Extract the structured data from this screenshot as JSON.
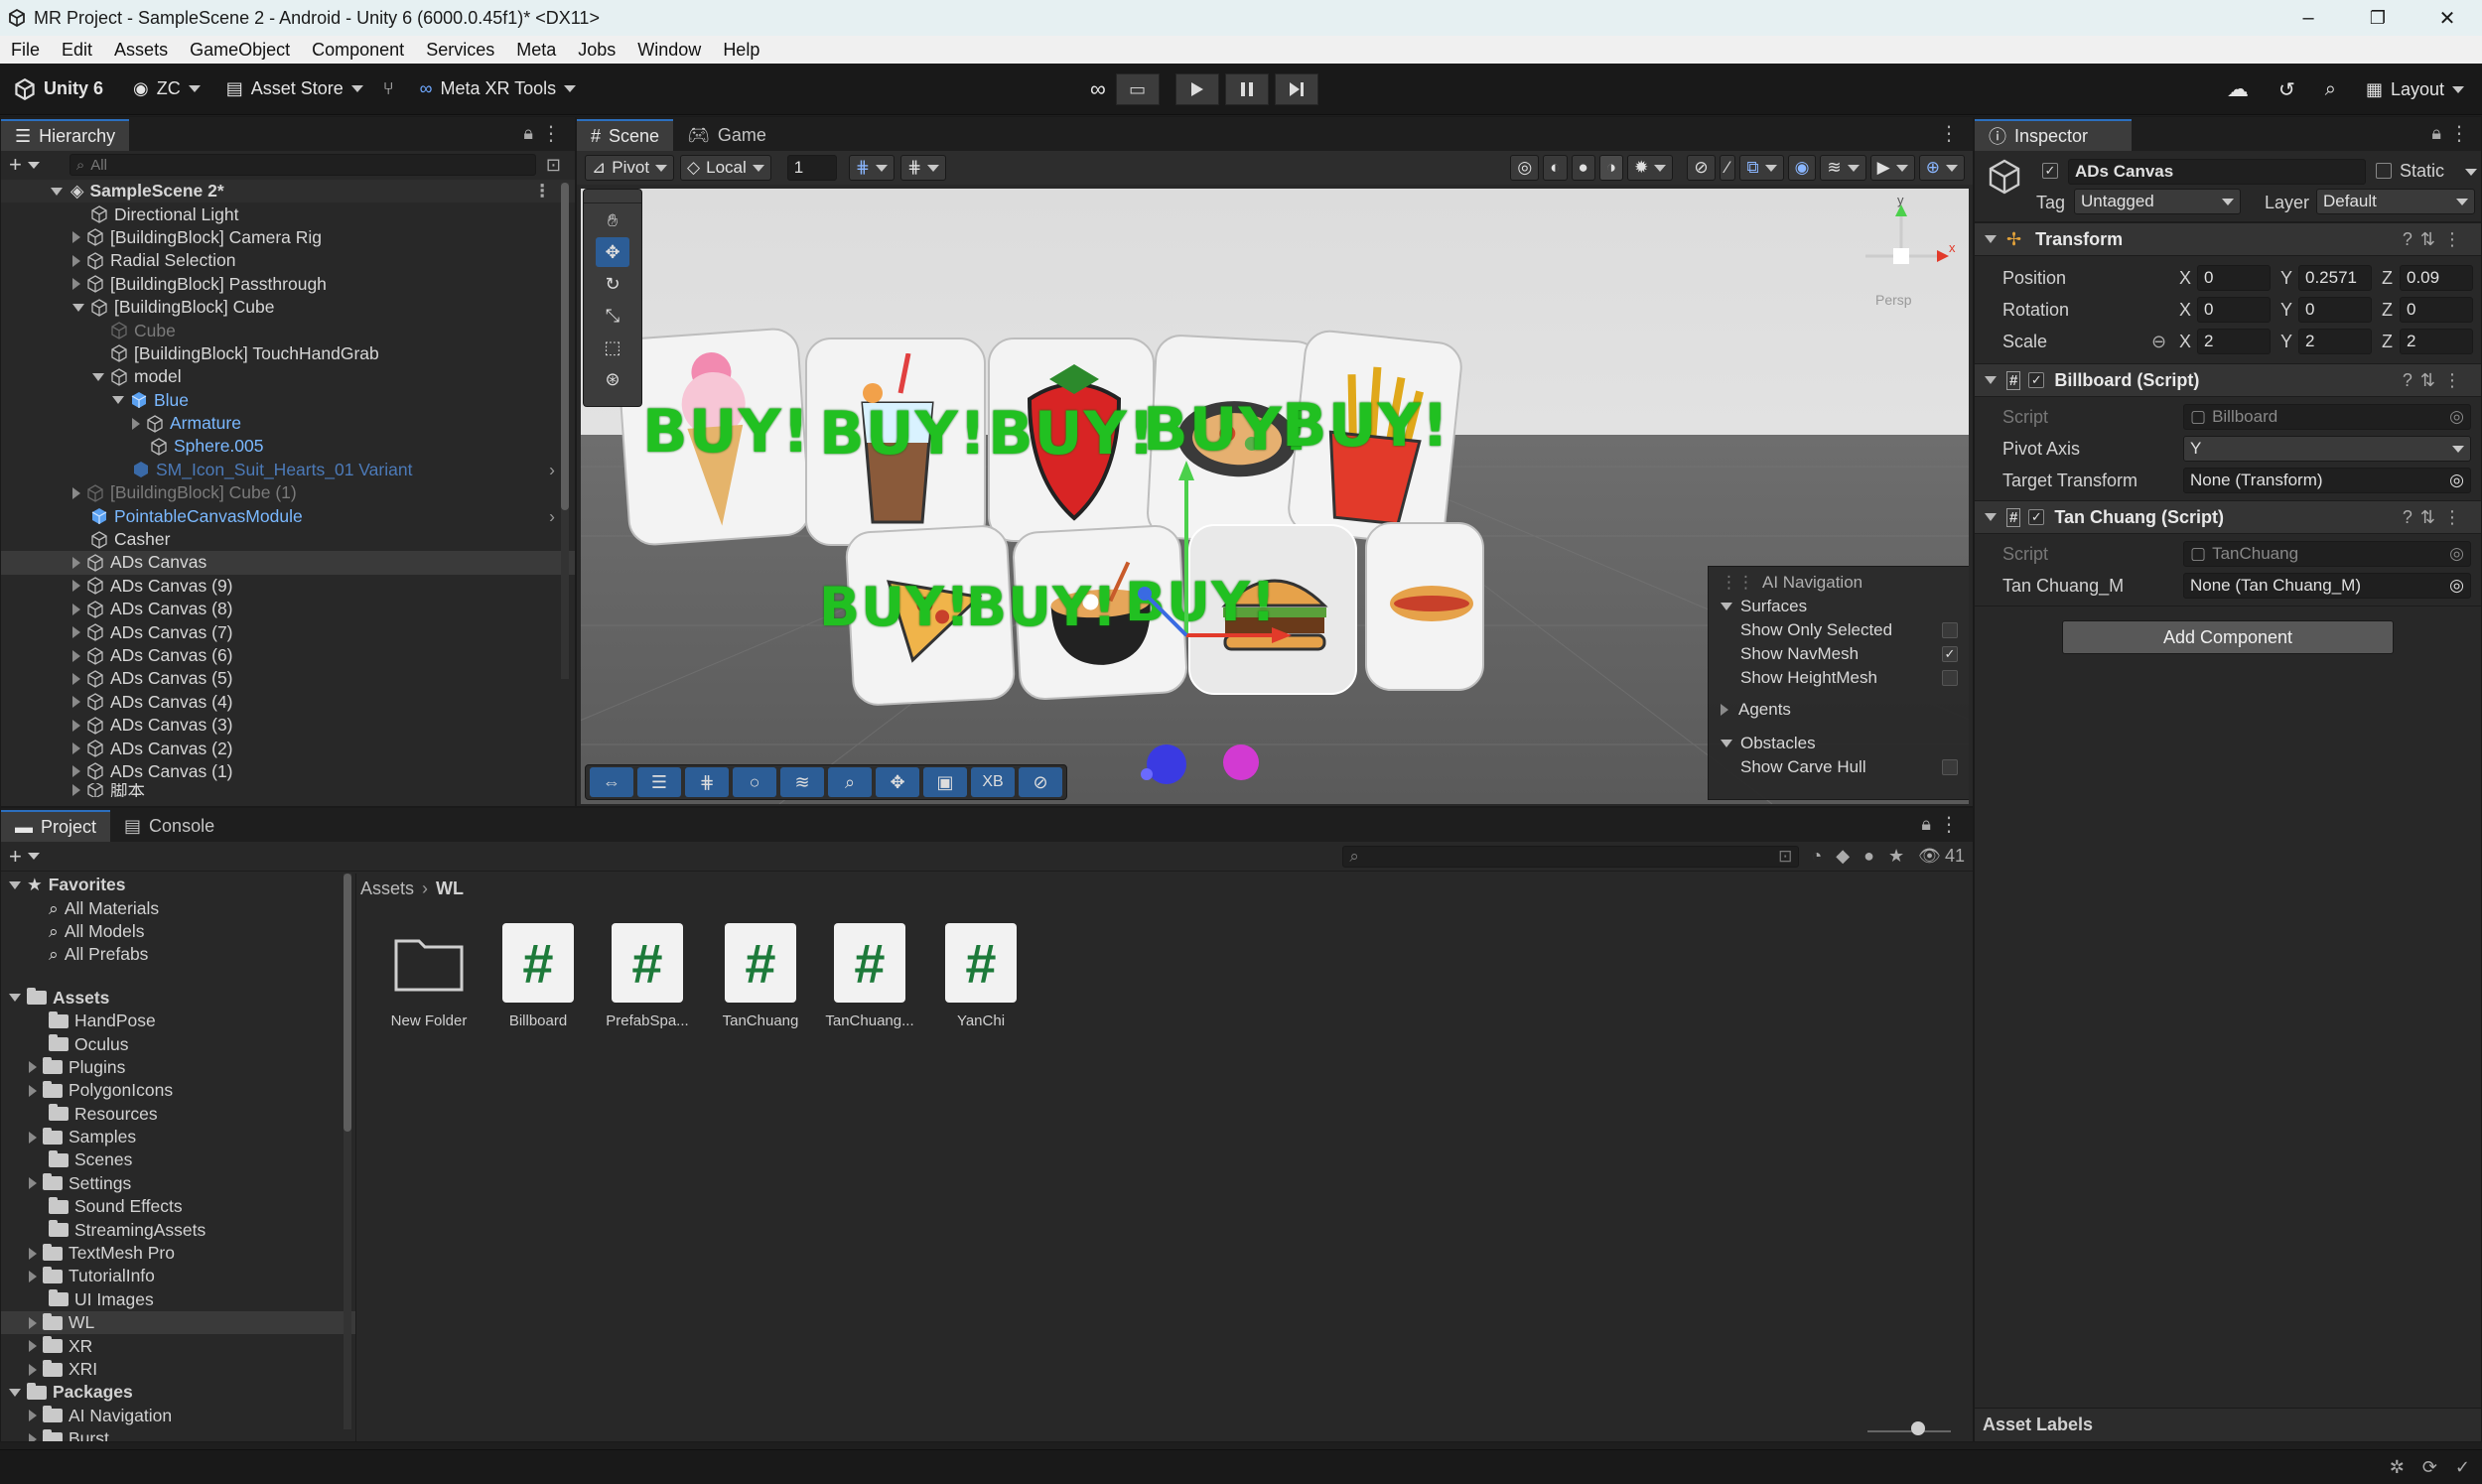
{
  "window": {
    "title": "MR Project - SampleScene 2 - Android - Unity 6 (6000.0.45f1)* <DX11>"
  },
  "menu": [
    "File",
    "Edit",
    "Assets",
    "GameObject",
    "Component",
    "Services",
    "Meta",
    "Jobs",
    "Window",
    "Help"
  ],
  "toolbar": {
    "unity_label": "Unity 6",
    "account": "ZC",
    "asset_store": "Asset Store",
    "meta_tools": "Meta XR Tools",
    "layout": "Layout"
  },
  "hierarchy": {
    "tab": "Hierarchy",
    "search_placeholder": "All",
    "scene": "SampleScene 2*",
    "items": [
      "Directional Light",
      "[BuildingBlock] Camera Rig",
      "Radial Selection",
      "[BuildingBlock] Passthrough",
      "[BuildingBlock] Cube",
      "Cube",
      "[BuildingBlock] TouchHandGrab",
      "model",
      "Blue",
      "Armature",
      "Sphere.005",
      "SM_Icon_Suit_Hearts_01 Variant",
      "[BuildingBlock] Cube (1)",
      "PointableCanvasModule",
      "Casher",
      "ADs Canvas",
      "ADs Canvas (9)",
      "ADs Canvas (8)",
      "ADs Canvas (7)",
      "ADs Canvas (6)",
      "ADs Canvas (5)",
      "ADs Canvas (4)",
      "ADs Canvas (3)",
      "ADs Canvas (2)",
      "ADs Canvas (1)",
      "脚本"
    ]
  },
  "scene": {
    "tab_scene": "Scene",
    "tab_game": "Game",
    "pivot": "Pivot",
    "local": "Local",
    "grid_value": "1",
    "persp": "Persp",
    "buy_text": "BUY!",
    "xb": "XB",
    "ai_overlay": {
      "title": "AI Navigation",
      "surfaces": "Surfaces",
      "show_only_selected": "Show Only Selected",
      "show_navmesh": "Show NavMesh",
      "show_heightmesh": "Show HeightMesh",
      "agents": "Agents",
      "obstacles": "Obstacles",
      "show_carve_hull": "Show Carve Hull"
    }
  },
  "project": {
    "tab_project": "Project",
    "tab_console": "Console",
    "count": "41",
    "favorites": {
      "label": "Favorites",
      "items": [
        "All Materials",
        "All Models",
        "All Prefabs"
      ]
    },
    "assets": {
      "label": "Assets",
      "items": [
        "HandPose",
        "Oculus",
        "Plugins",
        "PolygonIcons",
        "Resources",
        "Samples",
        "Scenes",
        "Settings",
        "Sound Effects",
        "StreamingAssets",
        "TextMesh Pro",
        "TutorialInfo",
        "UI Images",
        "WL",
        "XR",
        "XRI"
      ]
    },
    "packages": {
      "label": "Packages",
      "items": [
        "AI Navigation",
        "Burst"
      ]
    },
    "breadcrumb": {
      "root": "Assets",
      "current": "WL"
    },
    "files": [
      "New Folder",
      "Billboard",
      "PrefabSpa...",
      "TanChuang",
      "TanChuang...",
      "YanChi"
    ]
  },
  "inspector": {
    "tab": "Inspector",
    "object_name": "ADs Canvas",
    "static": "Static",
    "tag_label": "Tag",
    "tag": "Untagged",
    "layer_label": "Layer",
    "layer": "Default",
    "transform": {
      "title": "Transform",
      "position_label": "Position",
      "rotation_label": "Rotation",
      "scale_label": "Scale",
      "position": {
        "x": "0",
        "y": "0.2571",
        "z": "0.09"
      },
      "rotation": {
        "x": "0",
        "y": "0",
        "z": "0"
      },
      "scale": {
        "x": "2",
        "y": "2",
        "z": "2"
      }
    },
    "billboard": {
      "title": "Billboard (Script)",
      "script_label": "Script",
      "script": "Billboard",
      "pivot_label": "Pivot Axis",
      "pivot": "Y",
      "target_label": "Target Transform",
      "target": "None (Transform)"
    },
    "tanchuang": {
      "title": "Tan Chuang (Script)",
      "script_label": "Script",
      "script": "TanChuang",
      "field_label": "Tan Chuang_M",
      "field": "None (Tan Chuang_M)"
    },
    "add_component": "Add Component",
    "asset_labels": "Asset Labels"
  },
  "colors": {
    "accent": "#2c6fbf",
    "buy_green": "#21c021",
    "panel": "#282828"
  }
}
